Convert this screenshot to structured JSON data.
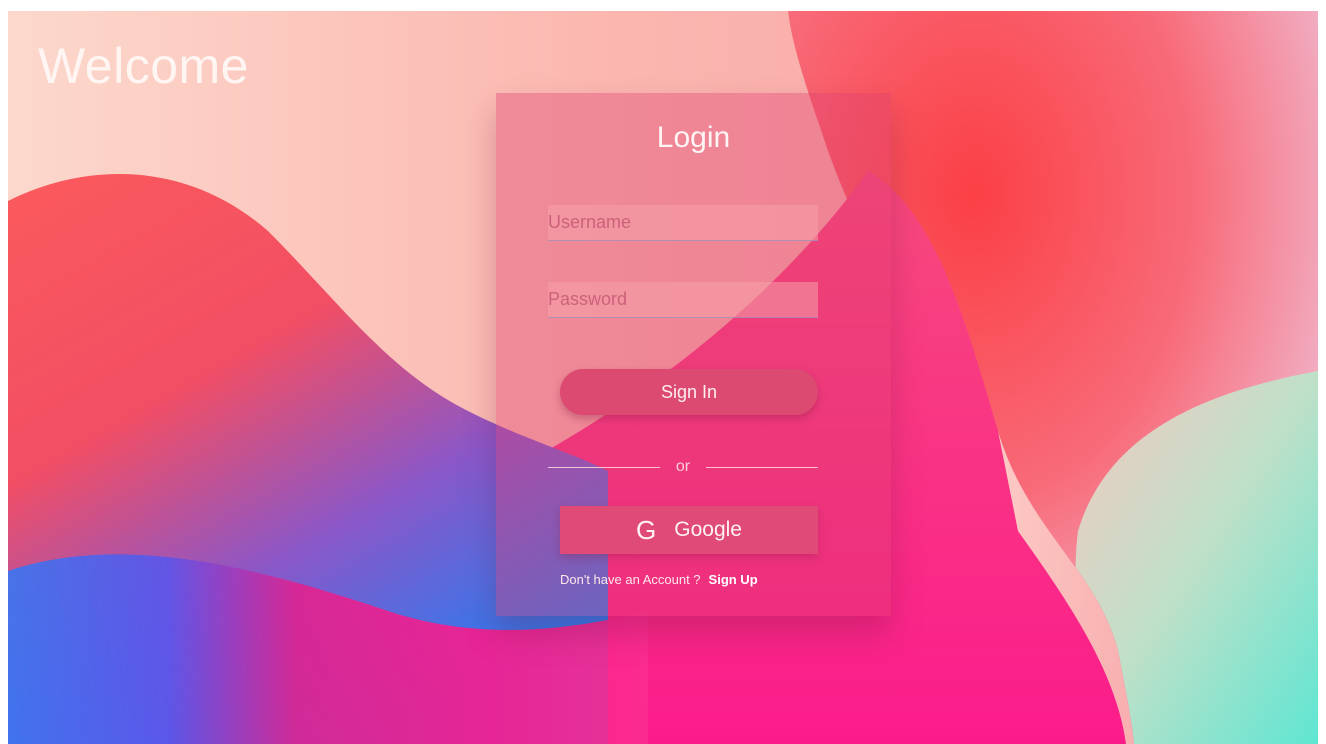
{
  "page": {
    "welcome_text": "Welcome"
  },
  "login": {
    "title": "Login",
    "username_placeholder": "Username",
    "password_placeholder": "Password",
    "signin_label": "Sign In",
    "divider_text": "or",
    "google_icon_glyph": "G",
    "google_label": "Google",
    "no_account_text": "Don't have an Account ?",
    "signup_label": "Sign Up"
  },
  "icons": {
    "google": "google-icon"
  },
  "colors": {
    "accent": "#dc4a72",
    "card_tint": "#dc3c6e",
    "text_light": "#fff4f4"
  }
}
